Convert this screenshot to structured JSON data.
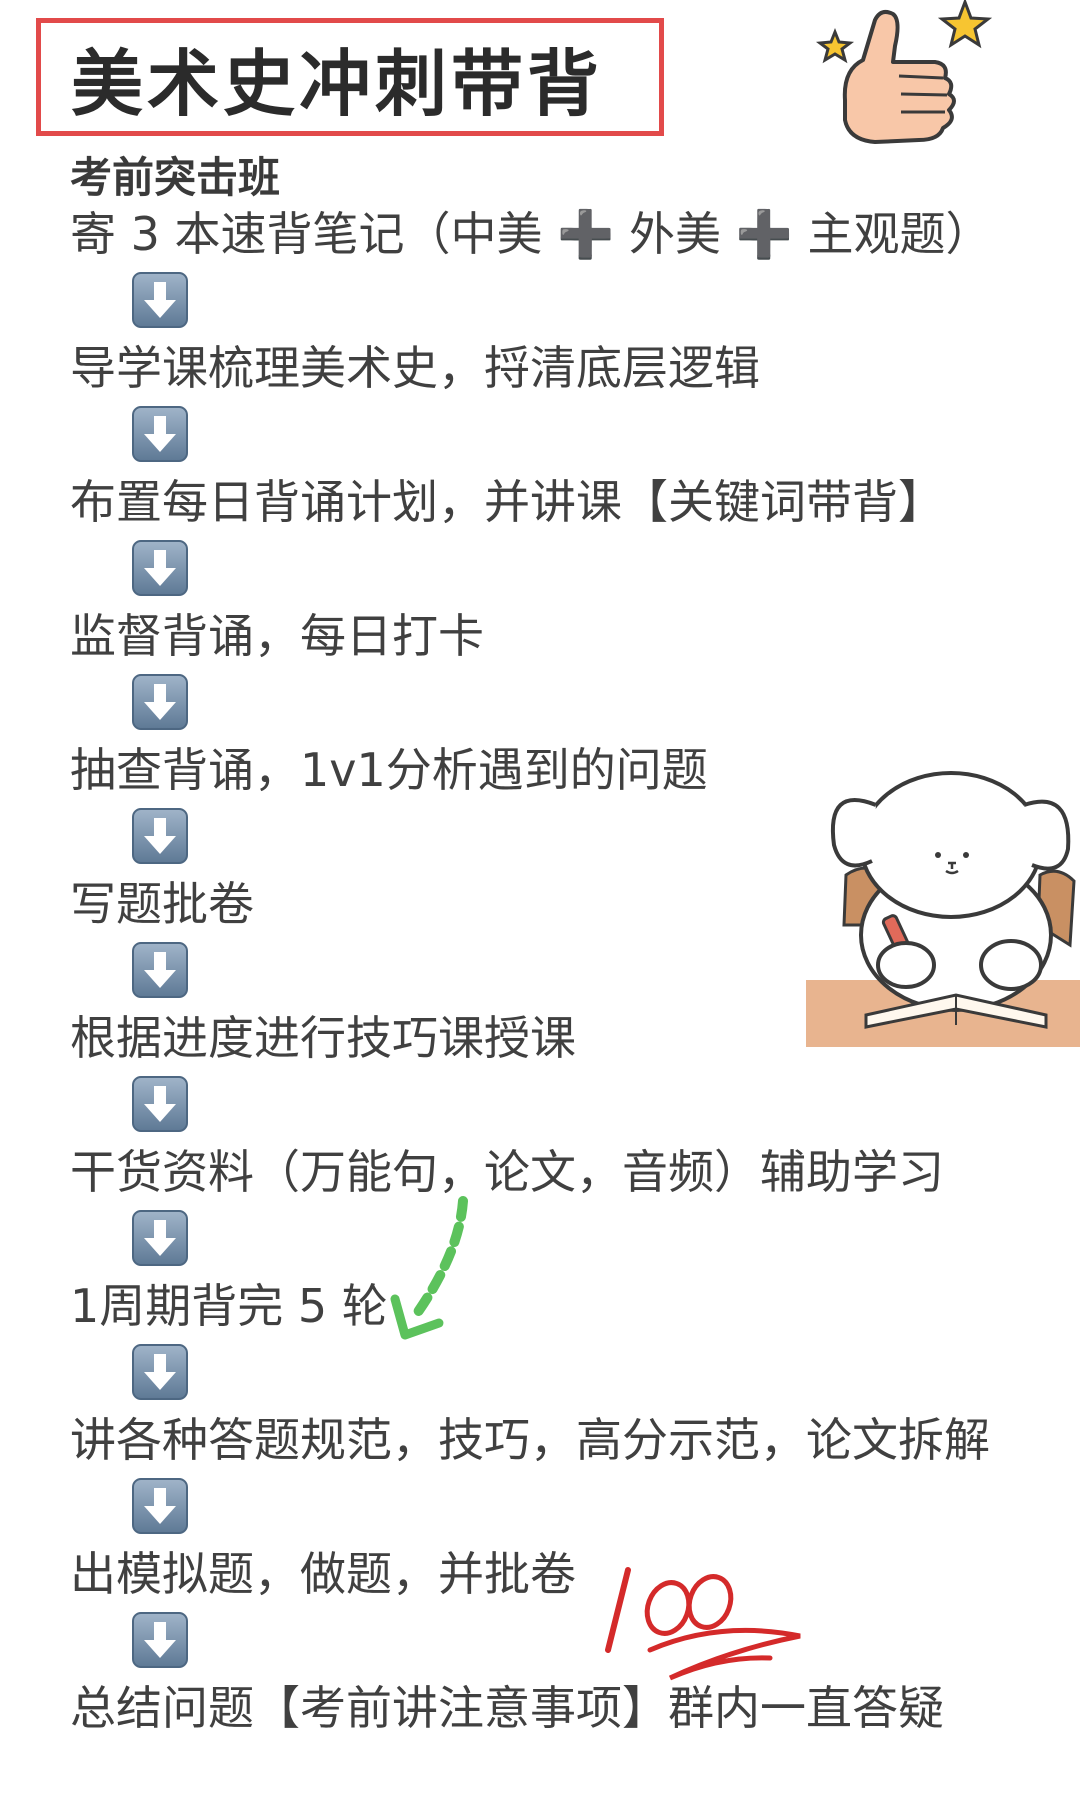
{
  "title": "美术史冲刺带背",
  "subtitle": "考前突击班",
  "steps": [
    "寄 3 本速背笔记（中美 ➕ 外美 ➕ 主观题）",
    "导学课梳理美术史，捋清底层逻辑",
    "布置每日背诵计划，并讲课【关键词带背】",
    "监督背诵，每日打卡",
    "抽查背诵，1v1分析遇到的问题",
    "写题批卷",
    "根据进度进行技巧课授课",
    "干货资料（万能句，论文，音频）辅助学习",
    "1周期背完 5 轮",
    "讲各种答题规范，技巧，高分示范，论文拆解",
    "出模拟题，做题，并批卷",
    "总结问题【考前讲注意事项】群内一直答疑"
  ],
  "arrow_icon": "down-arrow-icon",
  "colors": {
    "title_border": "#e24a4a",
    "arrow_bg": "#7a93ad",
    "check_green": "#5cc25c",
    "score_red": "#d42a2a"
  },
  "decorations": {
    "thumbs_up": "thumbs-up-sticker",
    "dog": "dog-studying-sticker",
    "dashed_arrow": "green-dashed-arrow",
    "score": "100-score-mark"
  }
}
